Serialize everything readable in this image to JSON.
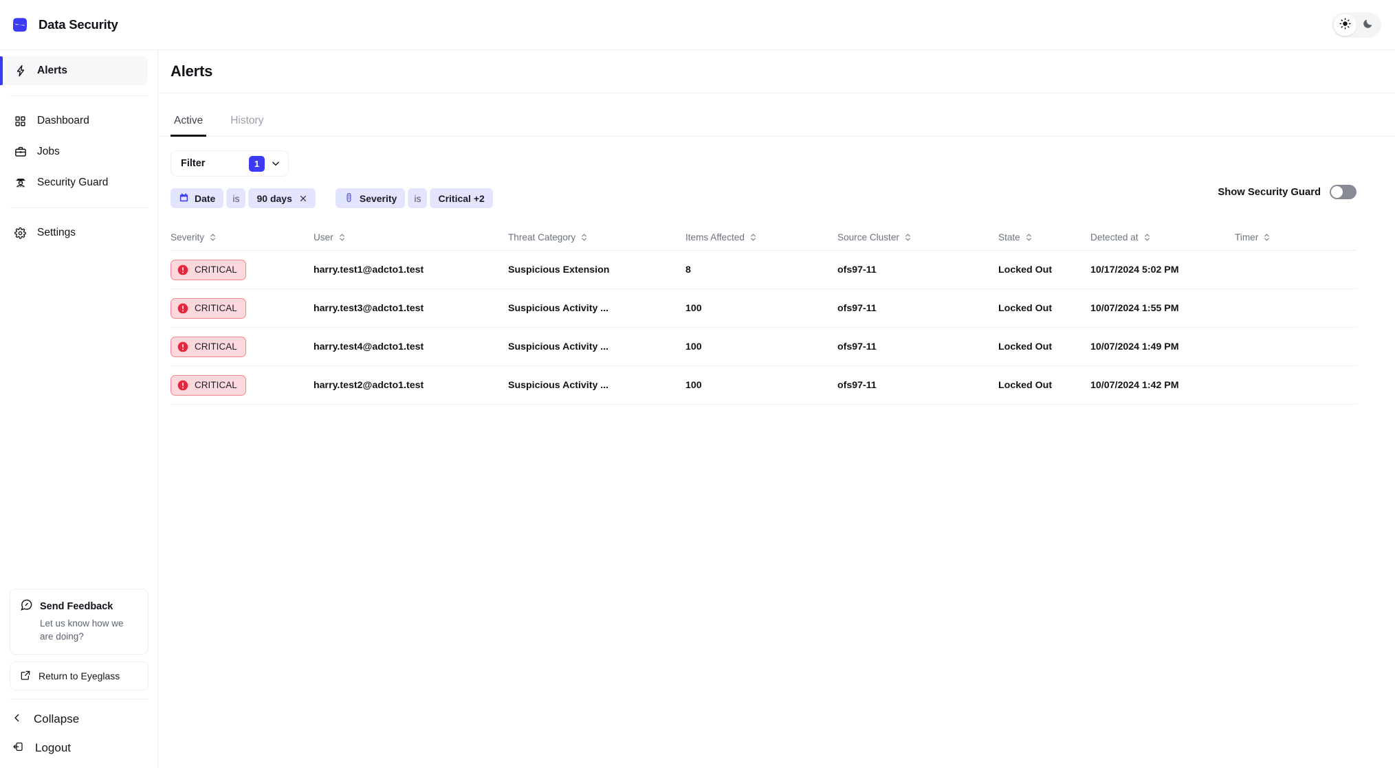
{
  "app": {
    "brand_name": "Data Security",
    "logo_icon": "data-security-logo",
    "theme": {
      "light_icon": "sun-icon",
      "dark_icon": "moon-icon",
      "active": "light"
    }
  },
  "sidebar": {
    "groups": [
      {
        "items": [
          {
            "label": "Alerts",
            "icon": "lightning-bolt-icon",
            "active": true
          }
        ]
      },
      {
        "items": [
          {
            "label": "Dashboard",
            "icon": "grid-icon",
            "active": false
          },
          {
            "label": "Jobs",
            "icon": "briefcase-icon",
            "active": false
          },
          {
            "label": "Security Guard",
            "icon": "guard-icon",
            "active": false
          }
        ]
      },
      {
        "items": [
          {
            "label": "Settings",
            "icon": "gear-icon",
            "active": false
          }
        ]
      }
    ],
    "feedback": {
      "icon": "feedback-chat-icon",
      "title": "Send Feedback",
      "subtitle": "Let us know how we are doing?"
    },
    "return_button": {
      "icon": "external-link-icon",
      "label": "Return to Eyeglass"
    },
    "collapse": {
      "icon": "chevron-left-icon",
      "label": "Collapse"
    },
    "logout": {
      "icon": "logout-icon",
      "label": "Logout"
    }
  },
  "main": {
    "page_title": "Alerts",
    "tabs": [
      {
        "label": "Active",
        "active": true
      },
      {
        "label": "History",
        "active": false
      }
    ],
    "filter": {
      "label": "Filter",
      "count": "1",
      "chevron_icon": "chevron-down-icon",
      "chips": [
        {
          "icon": "calendar-icon",
          "field": "Date",
          "operator": "is",
          "value": "90 days",
          "removable": true,
          "remove_icon": "close-icon"
        },
        {
          "icon": "severity-gauge-icon",
          "field": "Severity",
          "operator": "is",
          "value": "Critical +2",
          "removable": false
        }
      ]
    },
    "security_guard_toggle": {
      "label": "Show Security Guard",
      "enabled": false
    },
    "table": {
      "columns": [
        {
          "key": "severity",
          "label": "Severity",
          "sortable": true
        },
        {
          "key": "user",
          "label": "User",
          "sortable": true
        },
        {
          "key": "threat_category",
          "label": "Threat Category",
          "sortable": true
        },
        {
          "key": "items_affected",
          "label": "Items Affected",
          "sortable": true
        },
        {
          "key": "source_cluster",
          "label": "Source Cluster",
          "sortable": true
        },
        {
          "key": "state",
          "label": "State",
          "sortable": true
        },
        {
          "key": "detected_at",
          "label": "Detected at",
          "sortable": true
        },
        {
          "key": "timer",
          "label": "Timer",
          "sortable": true
        }
      ],
      "rows": [
        {
          "severity": "CRITICAL",
          "severity_icon": "alert-circle-icon",
          "user": "harry.test1@adcto1.test",
          "threat_category": "Suspicious Extension",
          "items_affected": "8",
          "source_cluster": "ofs97-11",
          "state": "Locked Out",
          "detected_at": "10/17/2024 5:02 PM",
          "timer": ""
        },
        {
          "severity": "CRITICAL",
          "severity_icon": "alert-circle-icon",
          "user": "harry.test3@adcto1.test",
          "threat_category": "Suspicious Activity ...",
          "items_affected": "100",
          "source_cluster": "ofs97-11",
          "state": "Locked Out",
          "detected_at": "10/07/2024 1:55 PM",
          "timer": ""
        },
        {
          "severity": "CRITICAL",
          "severity_icon": "alert-circle-icon",
          "user": "harry.test4@adcto1.test",
          "threat_category": "Suspicious Activity ...",
          "items_affected": "100",
          "source_cluster": "ofs97-11",
          "state": "Locked Out",
          "detected_at": "10/07/2024 1:49 PM",
          "timer": ""
        },
        {
          "severity": "CRITICAL",
          "severity_icon": "alert-circle-icon",
          "user": "harry.test2@adcto1.test",
          "threat_category": "Suspicious Activity ...",
          "items_affected": "100",
          "source_cluster": "ofs97-11",
          "state": "Locked Out",
          "detected_at": "10/07/2024 1:42 PM",
          "timer": ""
        }
      ]
    }
  },
  "colors": {
    "accent": "#3b3bf5",
    "chip_bg": "#e3e4fd",
    "critical_bg": "#fdd9dd",
    "critical_border": "#f7838f",
    "critical_dot": "#e8253c"
  }
}
